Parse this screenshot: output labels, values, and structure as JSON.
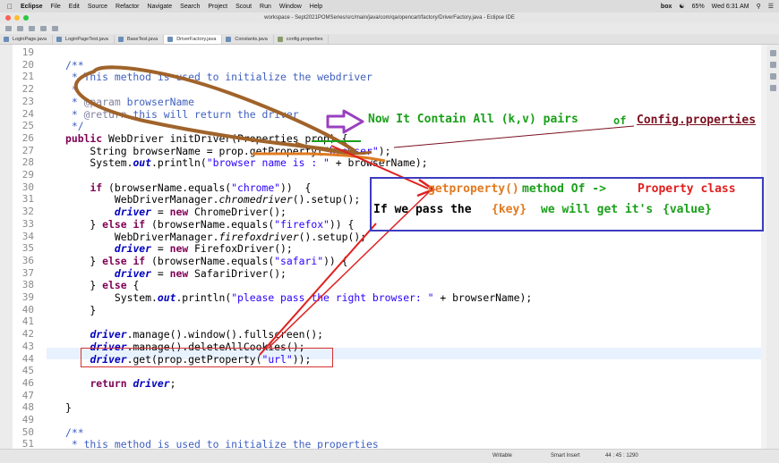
{
  "menubar": {
    "apple": "",
    "items": [
      "Eclipse",
      "File",
      "Edit",
      "Source",
      "Refactor",
      "Navigate",
      "Search",
      "Project",
      "Scout",
      "Run",
      "Window",
      "Help"
    ],
    "battery": "65%",
    "clock": "Wed 6:31 AM",
    "box_label": "box"
  },
  "window": {
    "title": "workspace - Sept2021POMSeries/src/main/java/com/qa/opencart/factory/DriverFactory.java - Eclipse IDE"
  },
  "tabs": [
    {
      "label": "LoginPage.java"
    },
    {
      "label": "LoginPageTest.java"
    },
    {
      "label": "BaseTest.java"
    },
    {
      "label": "DriverFactory.java"
    },
    {
      "label": "Constants.java"
    },
    {
      "label": "config.properties"
    }
  ],
  "editor": {
    "line_numbers": [
      "19",
      "20",
      "21",
      "22",
      "23",
      "24",
      "25",
      "26",
      "27",
      "28",
      "29",
      "30",
      "31",
      "32",
      "33",
      "34",
      "35",
      "36",
      "37",
      "38",
      "39",
      "40",
      "41",
      "42",
      "43",
      "44",
      "45",
      "46",
      "47",
      "48",
      "49",
      "50",
      "51"
    ]
  },
  "status": {
    "mode": "Writable",
    "insert": "Smart Insert",
    "position": "44 : 45 : 1290"
  },
  "annotations": {
    "contain_pairs": "Now It Contain All (k,v) pairs",
    "of_word": "of",
    "config_file": "Config.properties",
    "method_name": "getproperty()",
    "method_of": "method Of ->",
    "property_class": "Property class",
    "if_we_pass": "If we pass the",
    "key_text": "{key}",
    "we_will_get": "we will get it's",
    "value_text": "{value}",
    "colors": {
      "green": "#1aa01a",
      "maroon": "#7a1020",
      "red": "#e02020",
      "orange": "#e07a20",
      "purple": "#9a3fc0",
      "box_blue": "#3c3cc0",
      "brown": "#a0632a"
    }
  }
}
